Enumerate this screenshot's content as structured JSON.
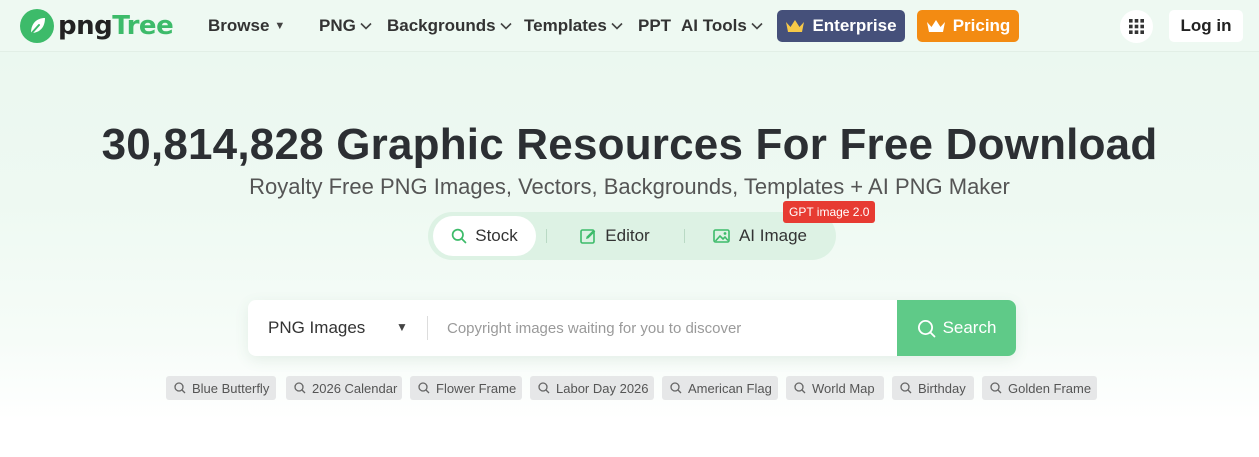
{
  "header": {
    "logo": {
      "text_dark": "png",
      "text_green": "Tree"
    },
    "nav": [
      {
        "label": "Browse",
        "dropdown": "triangle"
      },
      {
        "label": "PNG",
        "dropdown": "chevron"
      },
      {
        "label": "Backgrounds",
        "dropdown": "chevron"
      },
      {
        "label": "Templates",
        "dropdown": "chevron"
      },
      {
        "label": "PPT",
        "dropdown": "none"
      },
      {
        "label": "AI Tools",
        "dropdown": "chevron"
      }
    ],
    "enterprise_label": "Enterprise",
    "pricing_label": "Pricing",
    "login_label": "Log in"
  },
  "hero": {
    "title": "30,814,828 Graphic Resources For Free Download",
    "subtitle": "Royalty Free PNG Images, Vectors, Backgrounds, Templates + AI PNG Maker"
  },
  "modes": {
    "tabs": [
      {
        "label": "Stock",
        "icon": "search-icon",
        "active": true
      },
      {
        "label": "Editor",
        "icon": "edit-icon",
        "active": false
      },
      {
        "label": "AI Image",
        "icon": "image-icon",
        "active": false
      }
    ],
    "badge": "GPT image 2.0"
  },
  "search": {
    "category": "PNG Images",
    "placeholder": "Copyright images waiting for you to discover",
    "value": "",
    "button_label": "Search"
  },
  "tags": [
    "Blue Butterfly",
    "2026 Calendar",
    "Flower Frame",
    "Labor Day 2026",
    "American Flag",
    "World Map",
    "Birthday",
    "Golden Frame"
  ],
  "colors": {
    "brand_green": "#3dbb6a",
    "search_button": "#5fca88",
    "enterprise": "#45507a",
    "pricing": "#f38b12",
    "badge": "#e73b32"
  }
}
